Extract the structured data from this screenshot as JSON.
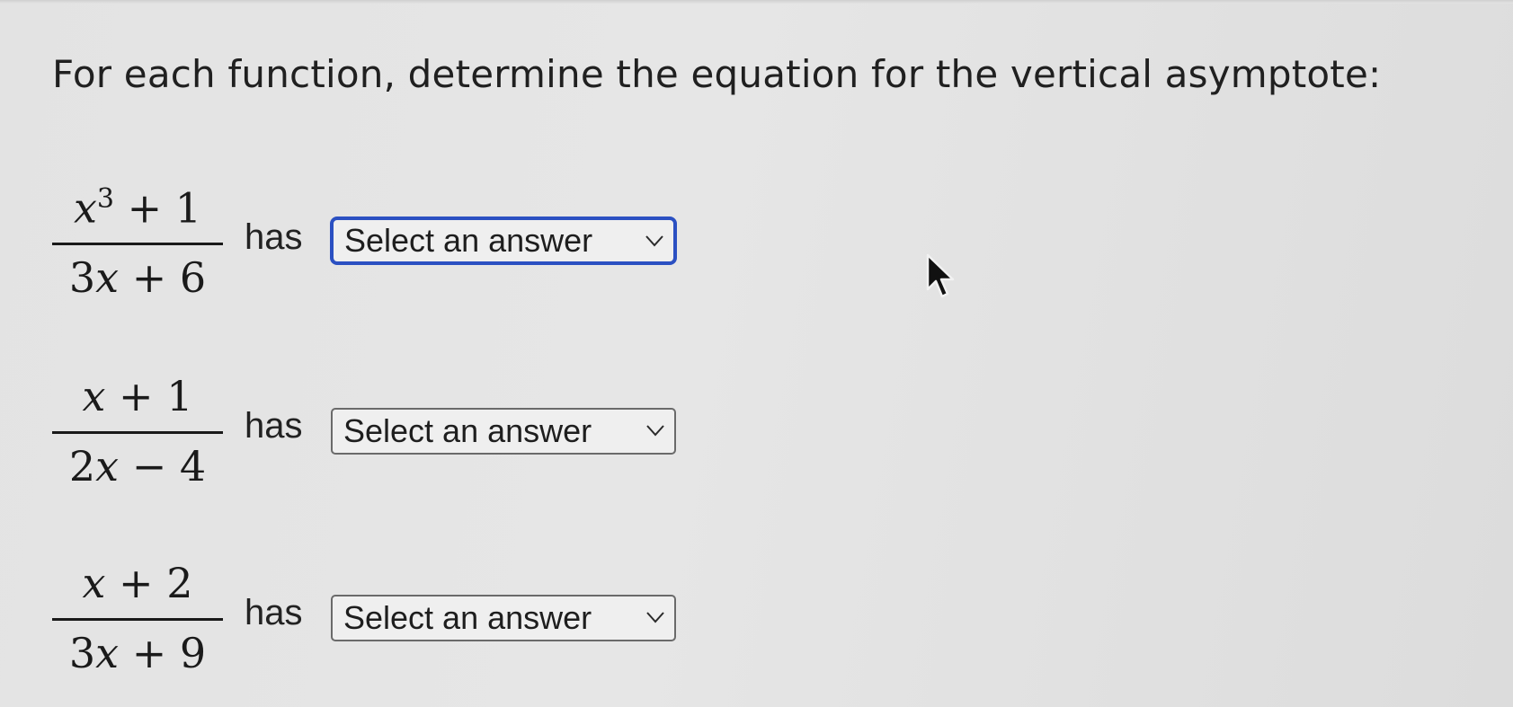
{
  "prompt": "For each function, determine the equation for the vertical asymptote:",
  "rows": [
    {
      "numerator": {
        "a": "x",
        "sup": "3",
        "rest": " + 1"
      },
      "denominator": {
        "coef": "3",
        "var": "x",
        "rest": " + 6"
      },
      "connector": "has",
      "select": {
        "value": "Select an answer",
        "focused": true
      }
    },
    {
      "numerator": {
        "a": "x",
        "sup": "",
        "rest": " + 1"
      },
      "denominator": {
        "coef": "2",
        "var": "x",
        "rest": " − 4"
      },
      "connector": "has",
      "select": {
        "value": "Select an answer",
        "focused": false
      }
    },
    {
      "numerator": {
        "a": "x",
        "sup": "",
        "rest": " + 2"
      },
      "denominator": {
        "coef": "3",
        "var": "x",
        "rest": " + 9"
      },
      "connector": "has",
      "select": {
        "value": "Select an answer",
        "focused": false
      }
    }
  ],
  "icons": {
    "dropdown": "chevron-down-icon",
    "pointer": "mouse-pointer-icon"
  },
  "colors": {
    "focus_ring": "#2b50c2",
    "background": "#e4e4e4",
    "text": "#1d1d1d"
  }
}
